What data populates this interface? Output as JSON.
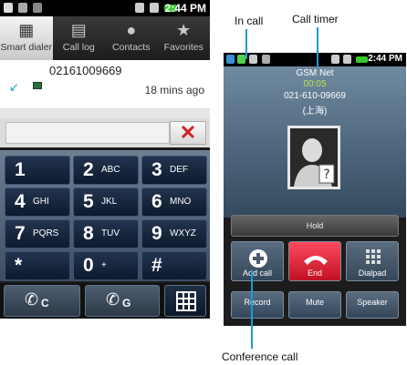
{
  "left_phone": {
    "status_time": "2:44 PM",
    "tabs": [
      {
        "label": "Smart dialer",
        "icon": "grid-icon"
      },
      {
        "label": "Call log",
        "icon": "list-icon"
      },
      {
        "label": "Contacts",
        "icon": "person-icon"
      },
      {
        "label": "Favorites",
        "icon": "star-icon"
      }
    ],
    "recent_call": {
      "number": "02161009669",
      "time_ago": "18 mins ago"
    },
    "input": {
      "value": ""
    },
    "keys": [
      {
        "digit": "1",
        "letters": ""
      },
      {
        "digit": "2",
        "letters": "ABC"
      },
      {
        "digit": "3",
        "letters": "DEF"
      },
      {
        "digit": "4",
        "letters": "GHI"
      },
      {
        "digit": "5",
        "letters": "JKL"
      },
      {
        "digit": "6",
        "letters": "MNO"
      },
      {
        "digit": "7",
        "letters": "PQRS"
      },
      {
        "digit": "8",
        "letters": "TUV"
      },
      {
        "digit": "9",
        "letters": "WXYZ"
      },
      {
        "digit": "*",
        "letters": ""
      },
      {
        "digit": "0",
        "letters": "+"
      },
      {
        "digit": "#",
        "letters": ""
      }
    ],
    "call_buttons": [
      {
        "label": "C"
      },
      {
        "label": "G"
      }
    ]
  },
  "right_phone": {
    "status_time": "2:44 PM",
    "network": "GSM Net",
    "timer": "00:05",
    "number": "021-610-09669",
    "location": "(上海)",
    "hold_label": "Hold",
    "row1": [
      {
        "label": "Add call",
        "icon": "plus-icon"
      },
      {
        "label": "End",
        "icon": "end-call-icon"
      },
      {
        "label": "Dialpad",
        "icon": "dialpad-icon"
      }
    ],
    "row2": [
      {
        "label": "Record"
      },
      {
        "label": "Mute"
      },
      {
        "label": "Speaker"
      }
    ]
  },
  "annotations": {
    "in_call": "In call",
    "call_timer": "Call timer",
    "conference_call": "Conference call"
  },
  "colors": {
    "accent": "#1a9bd7",
    "end_red": "#e01e33",
    "timer_green": "#b8e54a",
    "battery_green": "#39c829"
  }
}
